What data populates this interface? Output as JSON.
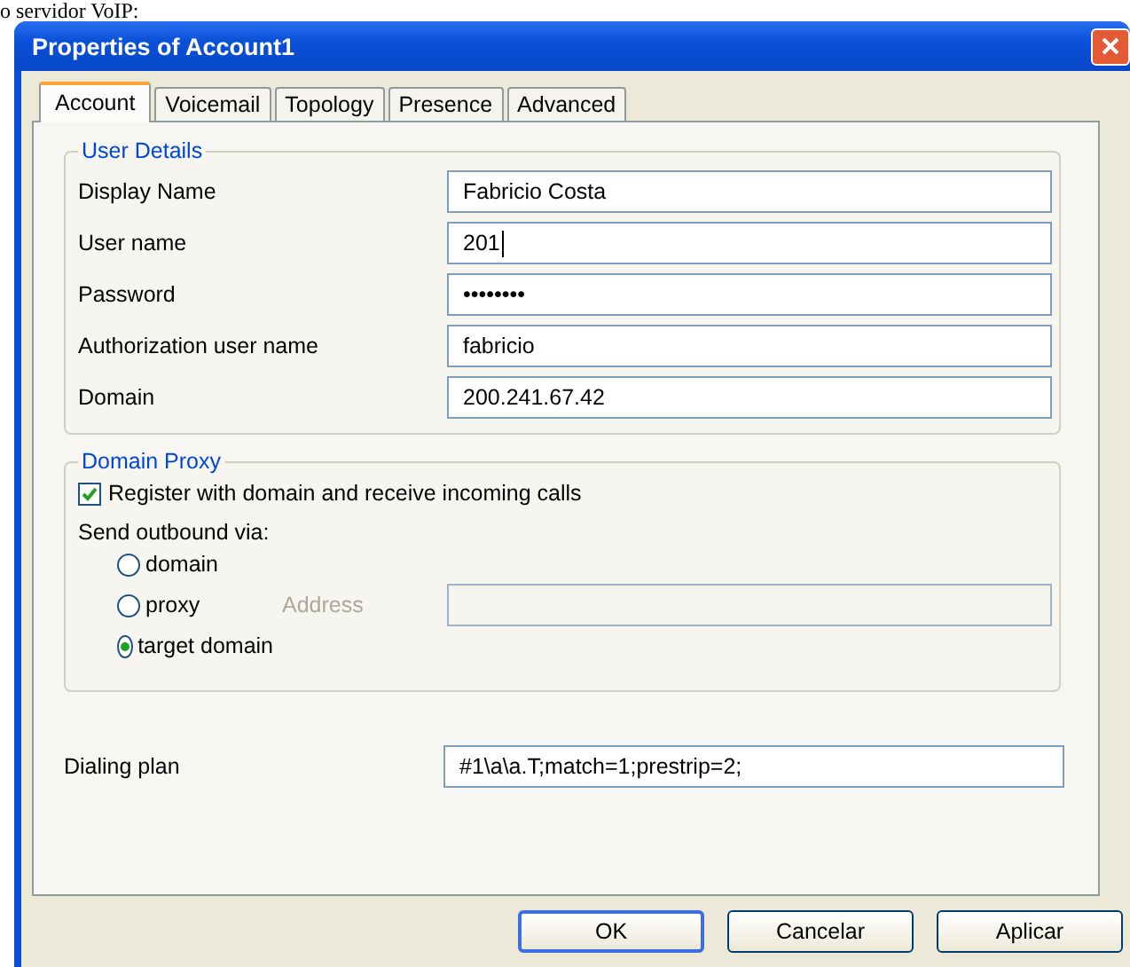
{
  "caption": "o servidor VoIP:",
  "window": {
    "title": "Properties of Account1"
  },
  "tabs": [
    {
      "label": "Account",
      "selected": true
    },
    {
      "label": "Voicemail",
      "selected": false
    },
    {
      "label": "Topology",
      "selected": false
    },
    {
      "label": "Presence",
      "selected": false
    },
    {
      "label": "Advanced",
      "selected": false
    }
  ],
  "user_details": {
    "title": "User Details",
    "fields": [
      {
        "label": "Display Name",
        "value": "Fabricio Costa",
        "focused": false
      },
      {
        "label": "User name",
        "value": "201",
        "focused": true
      },
      {
        "label": "Password",
        "value": "••••••••",
        "focused": false
      },
      {
        "label": "Authorization user name",
        "value": "fabricio",
        "focused": false
      },
      {
        "label": "Domain",
        "value": "200.241.67.42",
        "focused": false
      }
    ]
  },
  "domain_proxy": {
    "title": "Domain Proxy",
    "register": {
      "label": "Register with domain and receive incoming calls",
      "checked": true
    },
    "outbound_label": "Send outbound via:",
    "options": [
      {
        "label": "domain",
        "selected": false
      },
      {
        "label": "proxy",
        "selected": false
      },
      {
        "label": "target domain",
        "selected": true
      }
    ],
    "address": {
      "label": "Address",
      "disabled": true
    }
  },
  "dialing_plan": {
    "label": "Dialing plan",
    "value": "#1\\a\\a.T;match=1;prestrip=2;"
  },
  "buttons": [
    {
      "label": "OK",
      "default": true
    },
    {
      "label": "Cancelar",
      "default": false
    },
    {
      "label": "Aplicar",
      "default": false
    }
  ]
}
